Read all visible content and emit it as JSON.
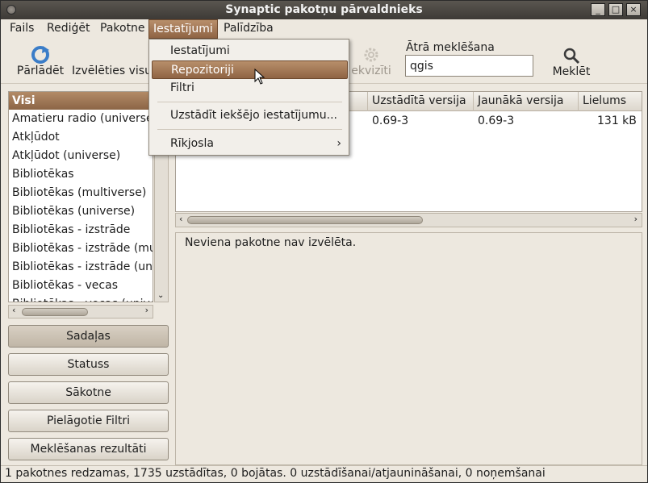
{
  "window": {
    "title": "Synaptic pakotņu pārvaldnieks",
    "controls": [
      "_",
      "□",
      "×"
    ]
  },
  "menubar": {
    "items": [
      "Fails",
      "Rediģēt",
      "Pakotne",
      "Iestatījumi",
      "Palīdzība"
    ]
  },
  "toolbar": {
    "reload_label": "Pārlādēt",
    "mark_all_label": "Izvēlēties visu",
    "properties_partial_label": "ekvizīti",
    "quick_search_label": "Ātrā meklēšana",
    "quick_search_value": "qgis",
    "search_label": "Meklēt"
  },
  "categories": {
    "header": "Visi",
    "items": [
      "Amatieru radio (universe)",
      "Atkļūdot",
      "Atkļūdot (universe)",
      "Bibliotēkas",
      "Bibliotēkas (multiverse)",
      "Bibliotēkas (universe)",
      "Bibliotēkas - izstrāde",
      "Bibliotēkas - izstrāde (mult",
      "Bibliotēkas - izstrāde (univ",
      "Bibliotēkas - vecas",
      "Bibliotēkas - vecas (univers"
    ]
  },
  "filter_buttons": [
    "Sadaļas",
    "Statuss",
    "Sākotne",
    "Pielāgotie Filtri",
    "Meklēšanas rezultāti"
  ],
  "package_table": {
    "columns": [
      "Uzstādītā versija",
      "Jaunākā versija",
      "Lielums"
    ],
    "rows": [
      {
        "installed": "0.69-3",
        "latest": "0.69-3",
        "size": "131 kB"
      }
    ]
  },
  "description": "Neviena pakotne nav izvēlēta.",
  "statusbar": "1 pakotnes redzamas, 1735 uzstādītas, 0 bojātas. 0 uzstādīšanai/atjaunināšanai, 0 noņemšanai",
  "dropdown": {
    "items": [
      "Iestatījumi",
      "Repozitoriji",
      "Filtri",
      "Uzstādīt iekšējo iestatījumu...",
      "Rīkjosla"
    ],
    "submenu_arrow": "›"
  },
  "colors": {
    "accent": "#8f6444",
    "window_bg": "#ede8df",
    "titlebar": "#3d3a36"
  }
}
